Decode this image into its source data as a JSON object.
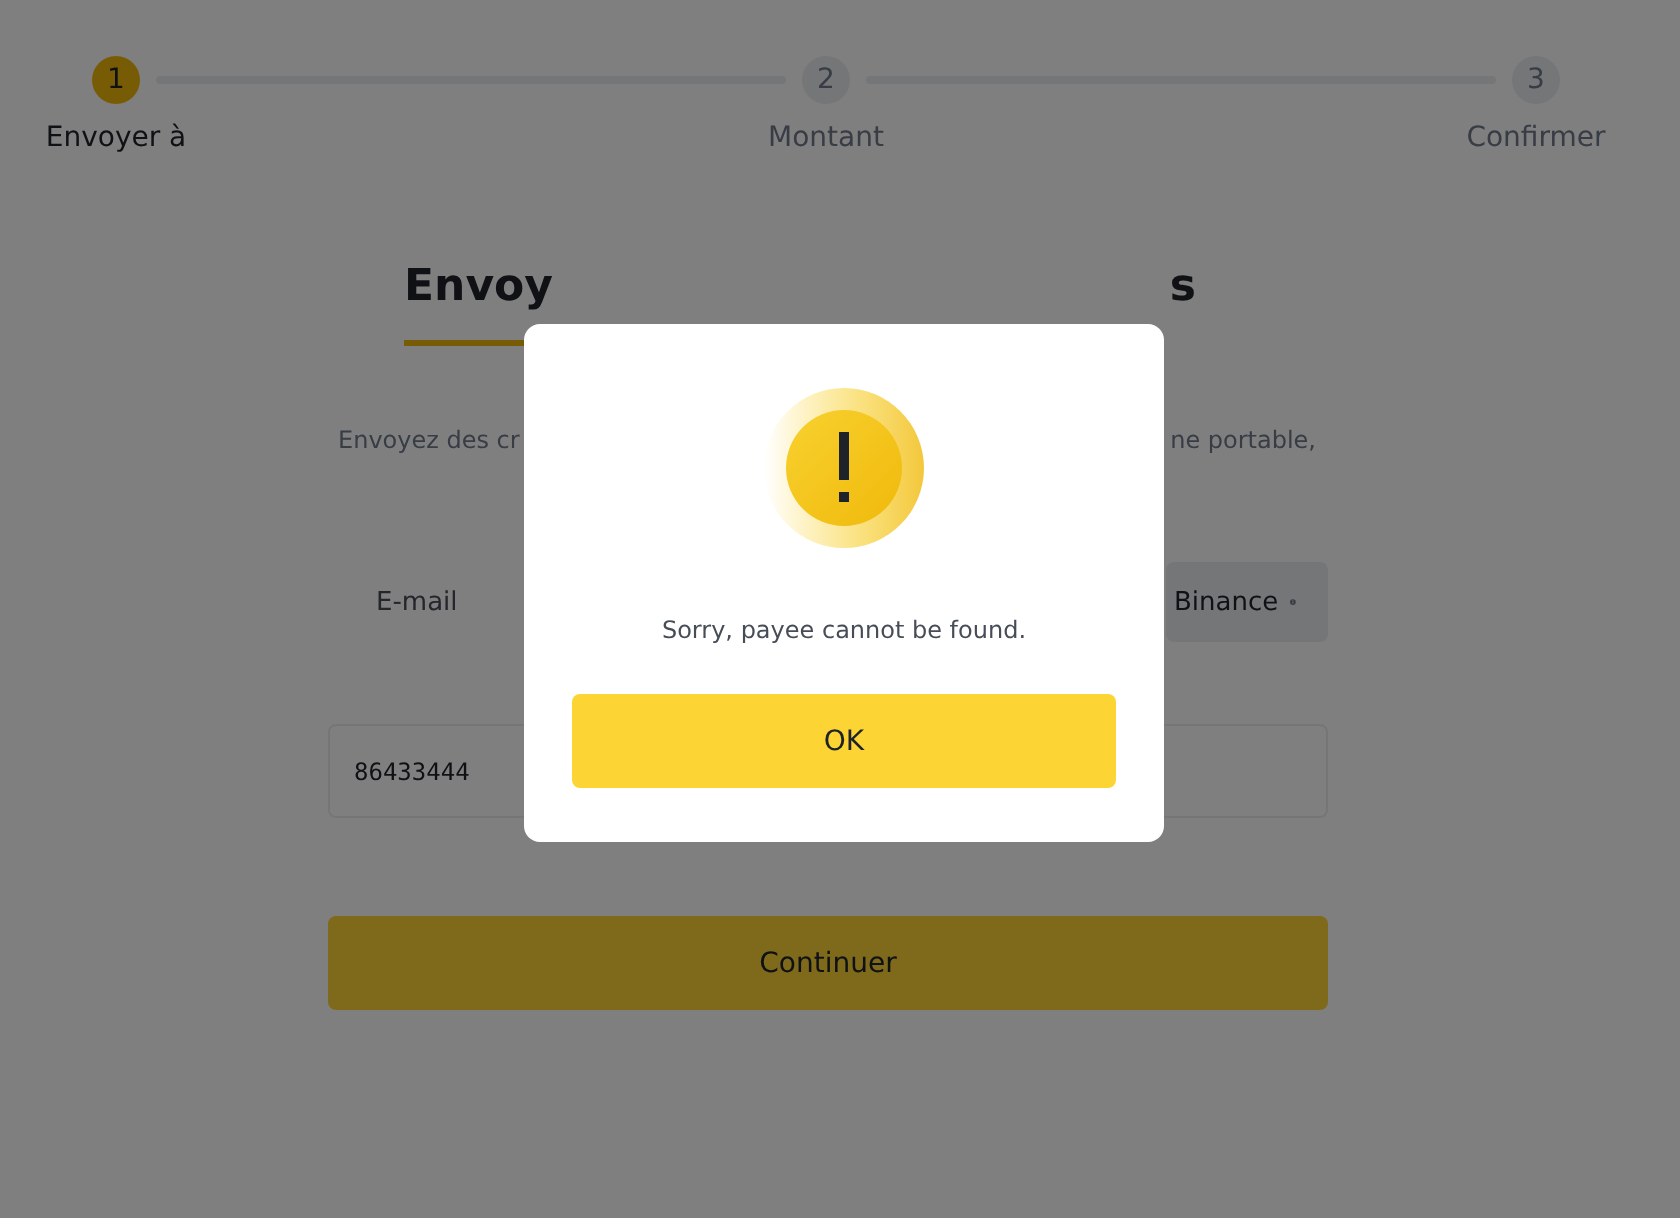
{
  "steps": [
    {
      "number": "1",
      "label": "Envoyer à",
      "selected": true
    },
    {
      "number": "2",
      "label": "Montant",
      "selected": false
    },
    {
      "number": "3",
      "label": "Confirmer",
      "selected": false
    }
  ],
  "title": {
    "fragments": [
      "Envoy",
      "s"
    ]
  },
  "description": {
    "fragments": [
      "Envoyez des cr",
      "ne portable,"
    ]
  },
  "tabs": [
    {
      "label": "E-mail",
      "selected": false
    },
    {
      "label": "Binance",
      "selected": true
    }
  ],
  "recipient_field": {
    "value": "86433444"
  },
  "continue_button": "Continuer",
  "dialog": {
    "message": "Sorry, payee cannot be found.",
    "button": "OK"
  }
}
